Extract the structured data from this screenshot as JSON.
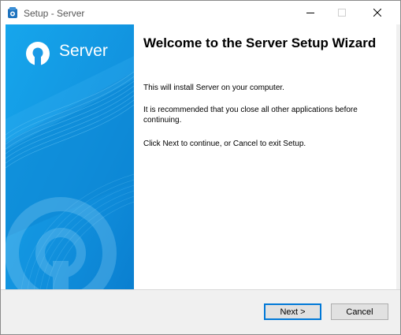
{
  "window": {
    "title": "Setup - Server",
    "icon": "setup-app-icon"
  },
  "titlebar_buttons": {
    "minimize_icon": "minimize-icon",
    "maximize_icon": "maximize-icon",
    "close_icon": "close-icon"
  },
  "side_panel": {
    "logo_text": "Server",
    "logo_icon": "server-logo-icon"
  },
  "main": {
    "heading": "Welcome to the Server Setup Wizard",
    "paragraph1": "This will install Server on your computer.",
    "paragraph2": "It is recommended that you close all other applications before continuing.",
    "paragraph3": "Click Next to continue, or Cancel to exit Setup."
  },
  "footer": {
    "next_label": "Next >",
    "cancel_label": "Cancel"
  },
  "colors": {
    "accent": "#0078d7",
    "panel_blue": "#1a9ae6",
    "panel_dark": "#0a78c8"
  }
}
